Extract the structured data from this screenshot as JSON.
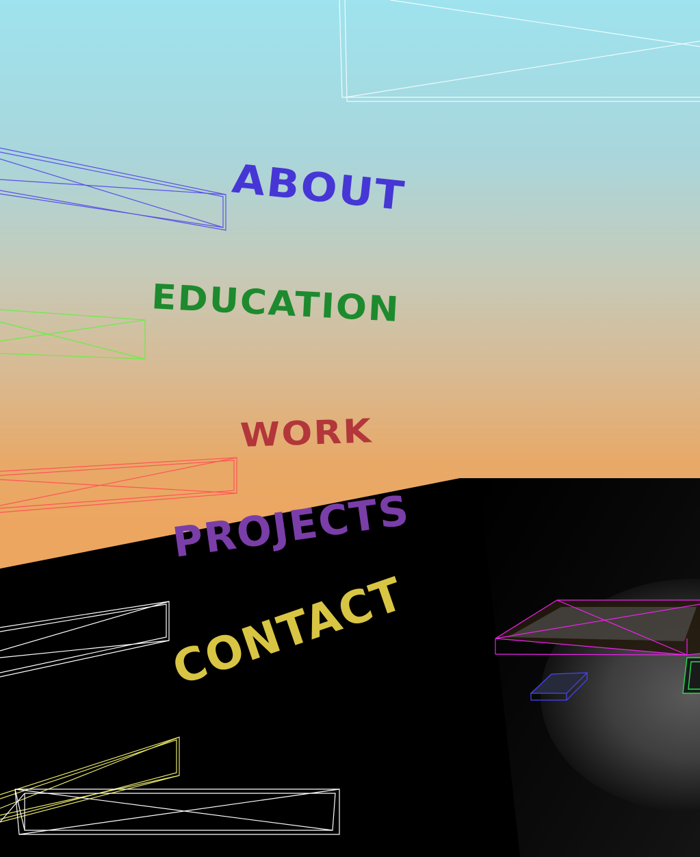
{
  "nav": {
    "about": {
      "label": "ABOUT",
      "color": "#4636d6"
    },
    "education": {
      "label": "EDUCATION",
      "color": "#1d8a2e"
    },
    "work": {
      "label": "WORK",
      "color": "#b2363a"
    },
    "projects": {
      "label": "PROJECTS",
      "color": "#7a3ea8"
    },
    "contact": {
      "label": "CONTACT",
      "color": "#d8c544"
    }
  },
  "colors": {
    "floor": "#000000",
    "spotlight": "#4a4a4a",
    "wire_cyan": "#e8fbff",
    "wire_blue": "#5a50e8",
    "wire_green": "#66ee44",
    "wire_red": "#ff5555",
    "wire_white": "#ffffff",
    "wire_yellow": "#e6e66a",
    "wire_magenta": "#ee22ee"
  }
}
